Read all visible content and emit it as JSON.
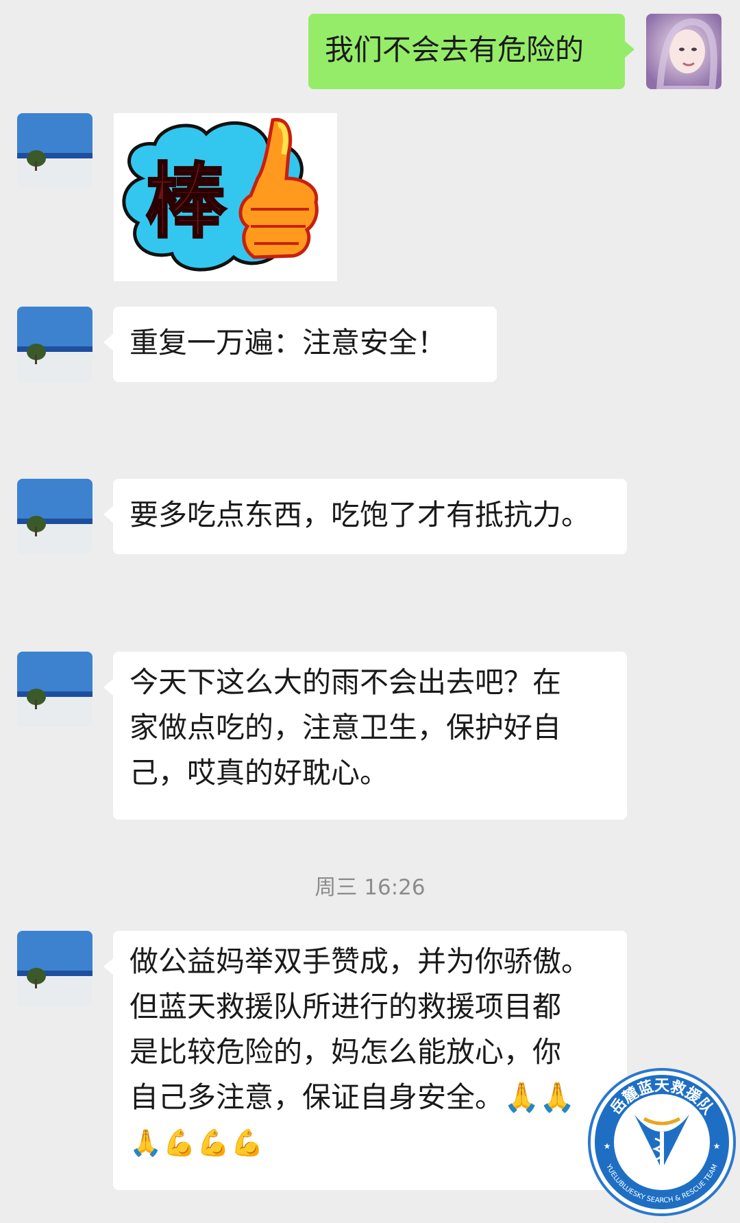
{
  "messages": {
    "m1": {
      "text": "我们不会去有危险的"
    },
    "m2": {
      "sticker_text": "棒"
    },
    "m3": {
      "text": "重复一万遍：注意安全！"
    },
    "m4": {
      "text": "要多吃点东西，吃饱了才有抵抗力。"
    },
    "m5": {
      "lines": [
        "今天下这么大的雨不会出去吧？在",
        "家做点吃的，注意卫生，保护好自",
        "己，哎真的好耽心。"
      ]
    },
    "timestamp": "周三 16:26",
    "m6": {
      "lines": [
        "做公益妈举双手赞成，并为你骄傲。",
        "但蓝天救援队所进行的救援项目都",
        "是比较危险的，妈怎么能放心，你",
        "自己多注意，保证自身安全。🙏🙏",
        "🙏💪💪💪"
      ]
    }
  },
  "watermark": {
    "title": "岳麓蓝天救援队",
    "subtitle": "YUELUBLUESKY SEARCH & RESCUE TEAM"
  },
  "colors": {
    "background": "#ededed",
    "outgoing_bubble": "#95ec69",
    "incoming_bubble": "#ffffff",
    "badge_blue": "#1e6fc4"
  }
}
